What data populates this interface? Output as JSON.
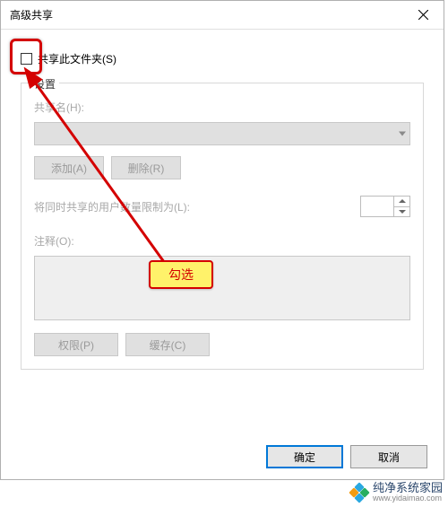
{
  "titlebar": {
    "title": "高级共享"
  },
  "checkbox": {
    "label": "共享此文件夹(S)"
  },
  "group": {
    "title": "设置",
    "shareNameLabel": "共享名(H):",
    "addBtn": "添加(A)",
    "removeBtn": "删除(R)",
    "limitLabel": "将同时共享的用户数量限制为(L):",
    "commentLabel": "注释(O):",
    "permBtn": "权限(P)",
    "cacheBtn": "缓存(C)"
  },
  "footer": {
    "ok": "确定",
    "cancel": "取消"
  },
  "annotation": {
    "callout": "勾选"
  },
  "watermark": {
    "brand": "纯净系统家园",
    "url": "www.yidaimao.com"
  }
}
